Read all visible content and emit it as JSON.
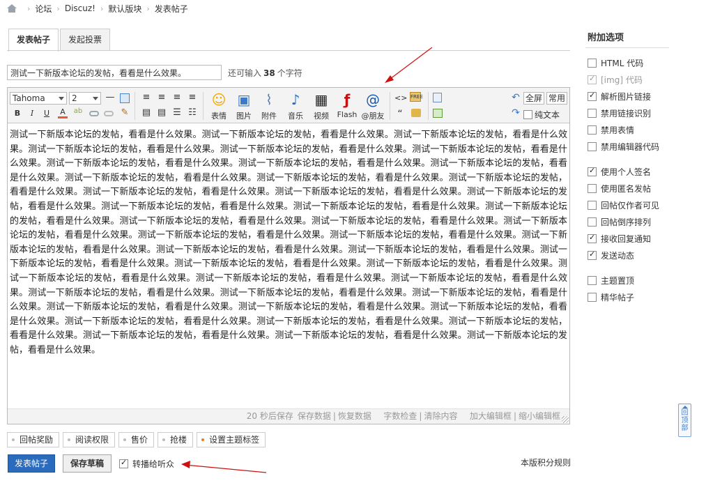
{
  "breadcrumb": {
    "items": [
      "论坛",
      "Discuz!",
      "默认版块",
      "发表帖子"
    ]
  },
  "tabs": [
    {
      "label": "发表帖子"
    },
    {
      "label": "发起投票"
    }
  ],
  "subject": {
    "value": "测试一下新版本论坛的发帖，看看是什么效果。",
    "remain_prefix": "还可输入",
    "remain_count": "38",
    "remain_suffix": "个字符"
  },
  "toolbar": {
    "font": "Tahoma",
    "size": "2",
    "buttons": [
      "表情",
      "图片",
      "附件",
      "音乐",
      "视频",
      "Flash",
      "@朋友"
    ],
    "fullscreen": "全屏",
    "common": "常用",
    "plaintext": "纯文本"
  },
  "editor": {
    "content": "测试一下新版本论坛的发帖，看看是什么效果。测试一下新版本论坛的发帖，看看是什么效果。测试一下新版本论坛的发帖，看看是什么效果。测试一下新版本论坛的发帖，看看是什么效果。测试一下新版本论坛的发帖，看看是什么效果。测试一下新版本论坛的发帖，看看是什么效果。测试一下新版本论坛的发帖，看看是什么效果。测试一下新版本论坛的发帖，看看是什么效果。测试一下新版本论坛的发帖，看看是什么效果。测试一下新版本论坛的发帖，看看是什么效果。测试一下新版本论坛的发帖，看看是什么效果。测试一下新版本论坛的发帖，看看是什么效果。测试一下新版本论坛的发帖，看看是什么效果。测试一下新版本论坛的发帖，看看是什么效果。测试一下新版本论坛的发帖，看看是什么效果。测试一下新版本论坛的发帖，看看是什么效果。测试一下新版本论坛的发帖，看看是什么效果。测试一下新版本论坛的发帖，看看是什么效果。测试一下新版本论坛的发帖，看看是什么效果。测试一下新版本论坛的发帖，看看是什么效果。测试一下新版本论坛的发帖，看看是什么效果。测试一下新版本论坛的发帖，看看是什么效果。测试一下新版本论坛的发帖，看看是什么效果。测试一下新版本论坛的发帖，看看是什么效果。测试一下新版本论坛的发帖，看看是什么效果。测试一下新版本论坛的发帖，看看是什么效果。测试一下新版本论坛的发帖，看看是什么效果。测试一下新版本论坛的发帖，看看是什么效果。测试一下新版本论坛的发帖，看看是什么效果。测试一下新版本论坛的发帖，看看是什么效果。测试一下新版本论坛的发帖，看看是什么效果。测试一下新版本论坛的发帖，看看是什么效果。测试一下新版本论坛的发帖，看看是什么效果。测试一下新版本论坛的发帖，看看是什么效果。测试一下新版本论坛的发帖，看看是什么效果。测试一下新版本论坛的发帖，看看是什么效果。测试一下新版本论坛的发帖，看看是什么效果。测试一下新版本论坛的发帖，看看是什么效果。测试一下新版本论坛的发帖，看看是什么效果。测试一下新版本论坛的发帖，看看是什么效果。测试一下新版本论坛的发帖，看看是什么效果。测试一下新版本论坛的发帖，看看是什么效果。测试一下新版本论坛的发帖，看看是什么效果。测试一下新版本论坛的发帖，看看是什么效果。",
    "status": {
      "autosave": "20 秒后保存",
      "save": "保存数据",
      "restore": "恢复数据",
      "wordcheck": "字数检查",
      "clear": "清除内容",
      "enlarge": "加大编辑框",
      "shrink": "缩小编辑框"
    }
  },
  "options_row": [
    "回帖奖励",
    "阅读权限",
    "售价",
    "抢楼",
    "设置主题标签"
  ],
  "actions": {
    "submit": "发表帖子",
    "draft": "保存草稿",
    "broadcast": "转播给听众",
    "rules": "本版积分规则"
  },
  "sidebar": {
    "title": "附加选项",
    "options": [
      {
        "label": "HTML 代码",
        "checked": false,
        "disabled": false
      },
      {
        "label": "[img] 代码",
        "checked": true,
        "disabled": true
      },
      {
        "label": "解析图片链接",
        "checked": true,
        "disabled": false
      },
      {
        "label": "禁用链接识别",
        "checked": false,
        "disabled": false
      },
      {
        "label": "禁用表情",
        "checked": false,
        "disabled": false
      },
      {
        "label": "禁用编辑器代码",
        "checked": false,
        "disabled": false
      },
      {
        "label": "使用个人签名",
        "checked": true,
        "disabled": false
      },
      {
        "label": "使用匿名发帖",
        "checked": false,
        "disabled": false
      },
      {
        "label": "回帖仅作者可见",
        "checked": false,
        "disabled": false
      },
      {
        "label": "回帖倒序排列",
        "checked": false,
        "disabled": false
      },
      {
        "label": "接收回复通知",
        "checked": true,
        "disabled": false
      },
      {
        "label": "发送动态",
        "checked": true,
        "disabled": false
      },
      {
        "label": "主题置顶",
        "checked": false,
        "disabled": false
      },
      {
        "label": "精华帖子",
        "checked": false,
        "disabled": false
      }
    ]
  },
  "backtop": "回顶部",
  "colors": {
    "primary": "#2b6bbd",
    "annotation": "#cc1111",
    "border": "#b9b9b9"
  }
}
